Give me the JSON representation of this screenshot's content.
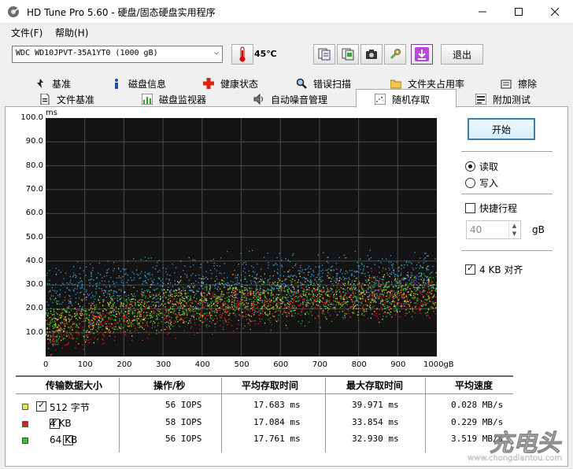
{
  "window": {
    "title": "HD Tune Pro 5.60 - 硬盘/固态硬盘实用程序"
  },
  "menu": {
    "file": "文件(F)",
    "help": "帮助(H)"
  },
  "toolbar": {
    "drive": "WDC WD10JPVT-35A1YT0 (1000 gB)",
    "temperature": "45℃",
    "exit_label": "退出",
    "icons": [
      "copy-info-icon",
      "copy-screenshot-icon",
      "camera-icon",
      "settings-icon",
      "save-download-icon"
    ]
  },
  "tabs": {
    "row1": [
      "基准",
      "磁盘信息",
      "健康状态",
      "错误扫描",
      "文件夹占用率",
      "擦除"
    ],
    "row2": [
      "文件基准",
      "磁盘监视器",
      "自动噪音管理",
      "随机存取",
      "附加测试"
    ],
    "active": "随机存取"
  },
  "chart_data": {
    "type": "scatter",
    "title": "",
    "xlabel": "",
    "ylabel": "ms",
    "x_unit": "gB",
    "xlim": [
      0,
      1000
    ],
    "ylim": [
      0,
      100
    ],
    "x_ticks": [
      "0",
      "100",
      "200",
      "300",
      "400",
      "500",
      "600",
      "700",
      "800",
      "900",
      "1000gB"
    ],
    "y_ticks": [
      "10.0",
      "20.0",
      "30.0",
      "40.0",
      "50.0",
      "60.0",
      "70.0",
      "80.0",
      "90.0",
      "100.0"
    ],
    "grid": true,
    "series": [
      {
        "name": "512 字节",
        "color": "#e8e840",
        "values_trend": {
          "x": [
            0,
            200,
            400,
            600,
            800,
            1000
          ],
          "y": [
            13,
            19,
            23,
            25,
            26,
            27
          ]
        }
      },
      {
        "name": "4 KB",
        "color": "#e02020",
        "values_trend": {
          "x": [
            0,
            200,
            400,
            600,
            800,
            1000
          ],
          "y": [
            10,
            16,
            20,
            23,
            25,
            26
          ]
        }
      },
      {
        "name": "64 KB",
        "color": "#30c030",
        "values_trend": {
          "x": [
            0,
            200,
            400,
            600,
            800,
            1000
          ],
          "y": [
            12,
            18,
            22,
            24,
            26,
            27
          ]
        }
      },
      {
        "name": "",
        "color": "#3aa0e0",
        "values_trend": {
          "x": [
            0,
            200,
            400,
            600,
            800,
            1000
          ],
          "y": [
            28,
            30,
            31,
            32,
            33,
            34
          ]
        }
      }
    ]
  },
  "controls": {
    "start_label": "开始",
    "read_label": "读取",
    "write_label": "写入",
    "read_selected": true,
    "short_stroke_label": "快捷行程",
    "short_stroke_checked": false,
    "short_stroke_value": "40",
    "short_stroke_unit": "gB",
    "align_label": "4 KB 对齐",
    "align_checked": true
  },
  "results": {
    "headers": [
      "传输数据大小",
      "操作/秒",
      "平均存取时间",
      "最大存取时间",
      "平均速度"
    ],
    "rows": [
      {
        "size": "512 字节",
        "color": "#e8e840",
        "iops": "56 IOPS",
        "avg": "17.683 ms",
        "max": "39.971 ms",
        "speed": "0.028 MB/s"
      },
      {
        "size": "4 KB",
        "color": "#e02020",
        "iops": "58 IOPS",
        "avg": "17.084 ms",
        "max": "33.854 ms",
        "speed": "0.229 MB/s"
      },
      {
        "size": "64 KB",
        "color": "#30c030",
        "iops": "56 IOPS",
        "avg": "17.761 ms",
        "max": "32.930 ms",
        "speed": "3.519 MB/s"
      }
    ]
  },
  "watermark": {
    "brand": "充电头",
    "url": "www.chongdiantou.com"
  }
}
